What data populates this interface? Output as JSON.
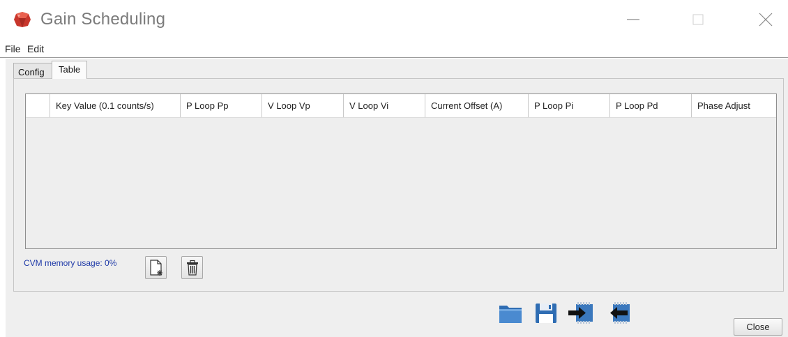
{
  "window": {
    "title": "Gain Scheduling",
    "icon": "ruby-gem-icon"
  },
  "menu": {
    "items": [
      {
        "label": "File"
      },
      {
        "label": "Edit"
      }
    ]
  },
  "tabs": [
    {
      "label": "Config",
      "selected": false
    },
    {
      "label": "Table",
      "selected": true
    }
  ],
  "table": {
    "columns": [
      "",
      "Key Value (0.1 counts/s)",
      "P Loop Pp",
      "V Loop Vp",
      "V Loop Vi",
      "Current Offset (A)",
      "P Loop Pi",
      "P Loop Pd",
      "Phase Adjust"
    ],
    "rows": []
  },
  "status": {
    "memory_usage": "CVM memory usage: 0%"
  },
  "buttons": {
    "close": "Close"
  },
  "toolbar_icons": [
    "new-row-icon",
    "trash-icon",
    "folder-icon",
    "save-icon",
    "download-to-drive-icon",
    "upload-from-drive-icon"
  ],
  "colors": {
    "memory_text": "#1f3aa8",
    "toolbar_blue": "#3f7fc0"
  }
}
